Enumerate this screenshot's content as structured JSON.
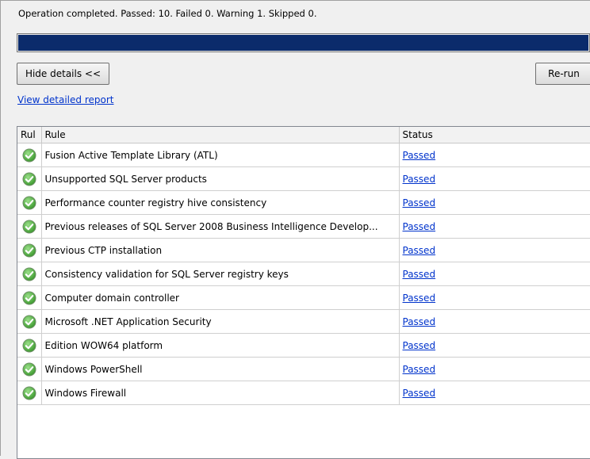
{
  "status_line": "Operation completed. Passed: 10.   Failed 0.   Warning 1.   Skipped 0.",
  "progress": {
    "fraction": 1.0,
    "color": "#0b2b6b"
  },
  "buttons": {
    "hide_details": "Hide details <<",
    "rerun": "Re-run"
  },
  "report_link": "View detailed report",
  "table": {
    "columns": [
      "Rul",
      "Rule",
      "Status"
    ],
    "rows": [
      {
        "icon": "check-circle-icon",
        "rule": "Fusion Active Template Library (ATL)",
        "status": "Passed"
      },
      {
        "icon": "check-circle-icon",
        "rule": "Unsupported SQL Server products",
        "status": "Passed"
      },
      {
        "icon": "check-circle-icon",
        "rule": "Performance counter registry hive consistency",
        "status": "Passed"
      },
      {
        "icon": "check-circle-icon",
        "rule": "Previous releases of SQL Server 2008 Business Intelligence Develop...",
        "status": "Passed"
      },
      {
        "icon": "check-circle-icon",
        "rule": "Previous CTP installation",
        "status": "Passed"
      },
      {
        "icon": "check-circle-icon",
        "rule": "Consistency validation for SQL Server registry keys",
        "status": "Passed"
      },
      {
        "icon": "check-circle-icon",
        "rule": "Computer domain controller",
        "status": "Passed"
      },
      {
        "icon": "check-circle-icon",
        "rule": "Microsoft .NET Application Security",
        "status": "Passed"
      },
      {
        "icon": "check-circle-icon",
        "rule": "Edition WOW64 platform",
        "status": "Passed"
      },
      {
        "icon": "check-circle-icon",
        "rule": "Windows PowerShell",
        "status": "Passed"
      },
      {
        "icon": "check-circle-icon",
        "rule": "Windows Firewall",
        "status": "Passed"
      }
    ]
  },
  "colors": {
    "link": "#0033cc",
    "success_icon": "#4caf3a"
  }
}
